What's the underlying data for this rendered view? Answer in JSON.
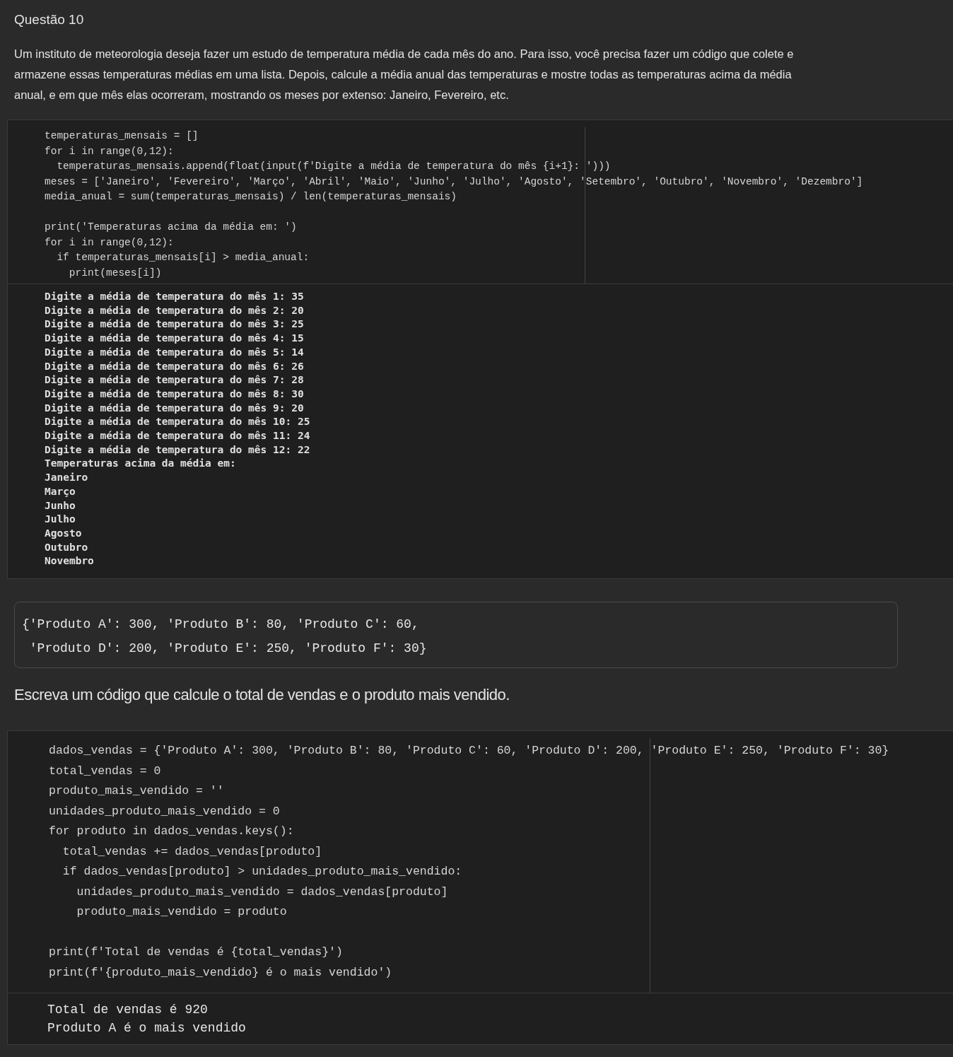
{
  "title": "Questão 10",
  "statement": "Um instituto de meteorologia deseja fazer um estudo de temperatura média de cada mês do ano. Para isso, você precisa fazer um código que colete e armazene essas temperaturas médias em uma lista. Depois, calcule a média anual das temperaturas e mostre todas as temperaturas acima da média anual, e em que mês elas ocorreram, mostrando os meses por extenso: Janeiro, Fevereiro, etc.",
  "cell_1": {
    "code_blocks": [
      [
        "temperaturas_mensais = []",
        "for i in range(0,12):",
        "  temperaturas_mensais.append(float(input(f'Digite a média de temperatura do mês {i+1}: ')))",
        "meses = ['Janeiro', 'Fevereiro', 'Março', 'Abril', 'Maio', 'Junho', 'Julho', 'Agosto', 'Setembro', 'Outubro', 'Novembro', 'Dezembro']",
        "media_anual = sum(temperaturas_mensais) / len(temperaturas_mensais)"
      ],
      [
        "print('Temperaturas acima da média em: ')",
        "for i in range(0,12):",
        "  if temperaturas_mensais[i] > media_anual:",
        "    print(meses[i])"
      ]
    ],
    "output": [
      "Digite a média de temperatura do mês 1: 35",
      "Digite a média de temperatura do mês 2: 20",
      "Digite a média de temperatura do mês 3: 25",
      "Digite a média de temperatura do mês 4: 15",
      "Digite a média de temperatura do mês 5: 14",
      "Digite a média de temperatura do mês 6: 26",
      "Digite a média de temperatura do mês 7: 28",
      "Digite a média de temperatura do mês 8: 30",
      "Digite a média de temperatura do mês 9: 20",
      "Digite a média de temperatura do mês 10: 25",
      "Digite a média de temperatura do mês 11: 24",
      "Digite a média de temperatura do mês 12: 22",
      "Temperaturas acima da média em:",
      "Janeiro",
      "Março",
      "Junho",
      "Julho",
      "Agosto",
      "Outubro",
      "Novembro"
    ]
  },
  "data_box": [
    "{'Produto A': 300, 'Produto B': 80, 'Produto C': 60,",
    " 'Produto D': 200, 'Produto E': 250, 'Produto F': 30}"
  ],
  "prompt": "Escreva um código que calcule o total de vendas e o produto mais vendido.",
  "cell_2": {
    "code_blocks": [
      [
        "dados_vendas = {'Produto A': 300, 'Produto B': 80, 'Produto C': 60, 'Produto D': 200, 'Produto E': 250, 'Produto F': 30}",
        "total_vendas = 0",
        "produto_mais_vendido = ''",
        "unidades_produto_mais_vendido = 0",
        "for produto in dados_vendas.keys():",
        "  total_vendas += dados_vendas[produto]",
        "  if dados_vendas[produto] > unidades_produto_mais_vendido:",
        "    unidades_produto_mais_vendido = dados_vendas[produto]",
        "    produto_mais_vendido = produto"
      ],
      [
        "print(f'Total de vendas é {total_vendas}')",
        "print(f'{produto_mais_vendido} é o mais vendido')"
      ]
    ],
    "output": [
      "Total de vendas é 920",
      "Produto A é o mais vendido"
    ]
  }
}
